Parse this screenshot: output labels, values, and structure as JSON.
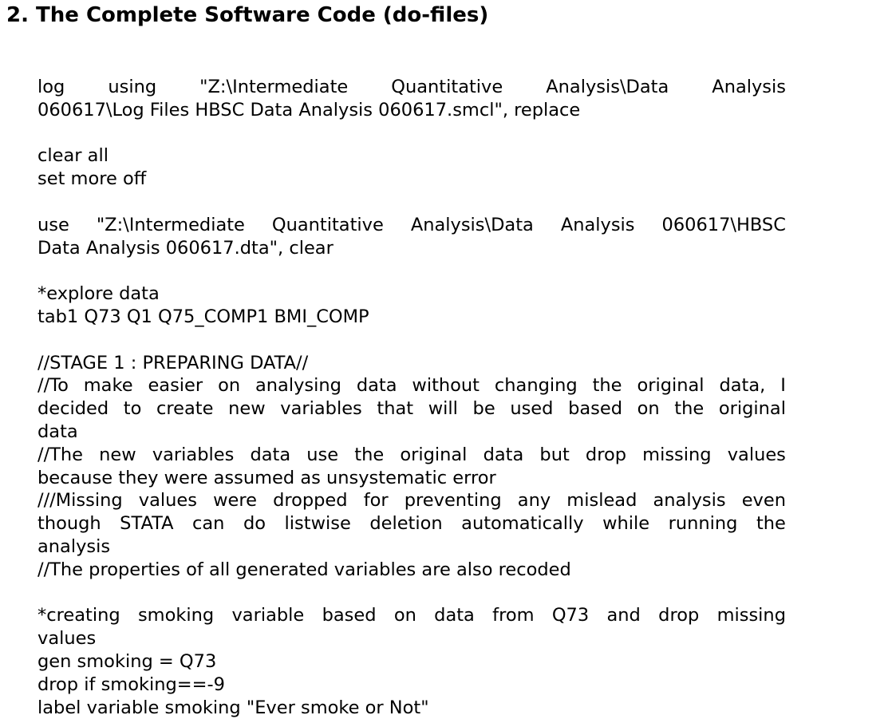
{
  "section_heading": "2. The Complete Software Code (do-files)",
  "code_blocks": [
    {
      "lines": [
        {
          "text": "log using \"Z:\\Intermediate Quantitative Analysis\\Data Analysis",
          "justify": true
        },
        {
          "text": "060617\\Log Files HBSC Data Analysis 060617.smcl\", replace",
          "justify": false
        }
      ]
    },
    {
      "lines": [
        {
          "text": "clear all",
          "justify": false
        },
        {
          "text": "set more off",
          "justify": false
        }
      ]
    },
    {
      "lines": [
        {
          "text": "use \"Z:\\Intermediate Quantitative Analysis\\Data Analysis 060617\\HBSC",
          "justify": true
        },
        {
          "text": "Data Analysis 060617.dta\", clear",
          "justify": false
        }
      ]
    },
    {
      "lines": [
        {
          "text": "*explore data",
          "justify": false
        },
        {
          "text": "tab1  Q73 Q1 Q75_COMP1 BMI_COMP",
          "justify": false
        }
      ]
    },
    {
      "lines": [
        {
          "text": "//STAGE 1 : PREPARING DATA//",
          "justify": false
        },
        {
          "text": "//To make easier on analysing data without changing the original data, I",
          "justify": true
        },
        {
          "text": "decided to create new variables that will be used based on the original",
          "justify": true
        },
        {
          "text": "data",
          "justify": false
        },
        {
          "text": "//The new variables data use the original data but drop missing values",
          "justify": true
        },
        {
          "text": "because they were assumed as unsystematic error",
          "justify": false
        },
        {
          "text": "///Missing values were dropped for preventing any mislead analysis even",
          "justify": true
        },
        {
          "text": "though STATA can do listwise deletion automatically while running the",
          "justify": true
        },
        {
          "text": "analysis",
          "justify": false
        },
        {
          "text": "//The properties of all generated variables are also recoded",
          "justify": false
        }
      ]
    },
    {
      "lines": [
        {
          "text": "*creating smoking variable based on data from Q73 and drop missing",
          "justify": true
        },
        {
          "text": "values",
          "justify": false
        },
        {
          "text": "gen smoking = Q73",
          "justify": false
        },
        {
          "text": "drop if smoking==-9",
          "justify": false
        },
        {
          "text": "label variable smoking \"Ever smoke or Not\"",
          "justify": false
        }
      ]
    }
  ]
}
